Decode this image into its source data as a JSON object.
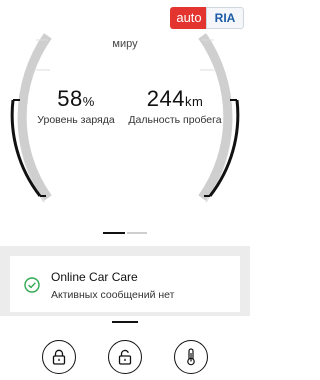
{
  "watermark": {
    "left": "auto",
    "right": "RIA"
  },
  "gauge": {
    "top_label": "миру",
    "charge": {
      "value": "58",
      "unit": "%",
      "caption": "Уровень заряда",
      "fraction": 0.58
    },
    "range": {
      "value": "244",
      "unit": "km",
      "caption": "Дальность пробега"
    }
  },
  "pager": {
    "active_index": 0,
    "count": 2
  },
  "care": {
    "title": "Online Car Care",
    "subtitle": "Активных сообщений нет"
  },
  "actions": [
    {
      "name": "lock-doors-button",
      "icon": "lock-closed-icon"
    },
    {
      "name": "unlock-doors-button",
      "icon": "lock-open-icon"
    },
    {
      "name": "climate-button",
      "icon": "thermometer-icon"
    }
  ],
  "colors": {
    "accent_ok": "#2fa84f",
    "brand_red": "#e3342f"
  }
}
